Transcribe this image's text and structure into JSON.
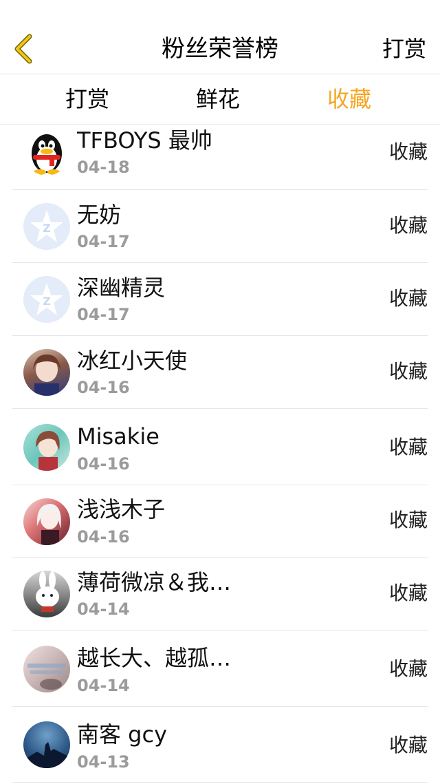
{
  "header": {
    "title": "粉丝荣誉榜",
    "right_label": "打赏",
    "back_color": "#f5c518"
  },
  "tabs": [
    {
      "label": "打赏"
    },
    {
      "label": "鲜花"
    },
    {
      "label": "收藏",
      "active": true
    }
  ],
  "accent": "#f5a623",
  "list": [
    {
      "name": "TFBOYS 最帅",
      "date": "04-18",
      "action": "收藏",
      "avatar": "qq-penguin-icon"
    },
    {
      "name": "无妨",
      "date": "04-17",
      "action": "收藏",
      "avatar": "default-star-avatar"
    },
    {
      "name": "深幽精灵",
      "date": "04-17",
      "action": "收藏",
      "avatar": "default-star-avatar"
    },
    {
      "name": "冰红小天使",
      "date": "04-16",
      "action": "收藏",
      "avatar": "anime-girl-avatar"
    },
    {
      "name": "Misakie",
      "date": "04-16",
      "action": "收藏",
      "avatar": "anime-girl-avatar"
    },
    {
      "name": "浅浅木子",
      "date": "04-16",
      "action": "收藏",
      "avatar": "anime-girl-avatar"
    },
    {
      "name": "薄荷微凉＆我…",
      "date": "04-14",
      "action": "收藏",
      "avatar": "rabbit-avatar"
    },
    {
      "name": "越长大、越孤…",
      "date": "04-14",
      "action": "收藏",
      "avatar": "photo-avatar"
    },
    {
      "name": "南客 gcy",
      "date": "04-13",
      "action": "收藏",
      "avatar": "wolf-night-avatar"
    }
  ]
}
